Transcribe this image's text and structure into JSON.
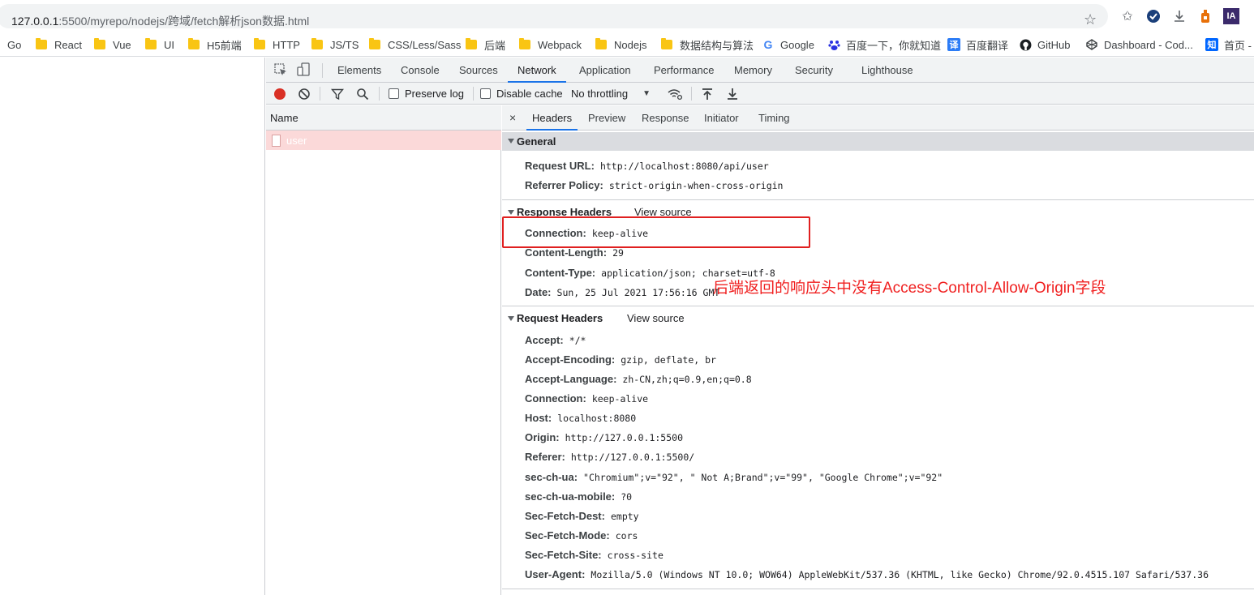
{
  "address_bar": {
    "info": "i",
    "url_host": "127.0.0.1",
    "url_rest": ":5500/myrepo/nodejs/跨域/fetch解析json数据.html"
  },
  "bookmarks": [
    {
      "label": "Go",
      "icon": "none"
    },
    {
      "label": "React",
      "icon": "folder"
    },
    {
      "label": "Vue",
      "icon": "folder"
    },
    {
      "label": "UI",
      "icon": "folder"
    },
    {
      "label": "H5前端",
      "icon": "folder"
    },
    {
      "label": "HTTP",
      "icon": "folder"
    },
    {
      "label": "JS/TS",
      "icon": "folder"
    },
    {
      "label": "CSS/Less/Sass",
      "icon": "folder"
    },
    {
      "label": "后端",
      "icon": "folder"
    },
    {
      "label": "Webpack",
      "icon": "folder"
    },
    {
      "label": "Nodejs",
      "icon": "folder"
    },
    {
      "label": "数据结构与算法",
      "icon": "folder"
    },
    {
      "label": "Google",
      "icon": "google-icon"
    },
    {
      "label": "百度一下，你就知道",
      "icon": "baidu-icon"
    },
    {
      "label": "百度翻译",
      "icon": "translate-icon"
    },
    {
      "label": "GitHub",
      "icon": "github-icon"
    },
    {
      "label": "Dashboard - Cod...",
      "icon": "codepen-icon"
    },
    {
      "label": "首页 -",
      "icon": "zhihu-icon"
    }
  ],
  "favicon_glyphs": {
    "translate": "译",
    "zhihu": "知",
    "ia": "IA"
  },
  "devtools": {
    "tabs": [
      "Elements",
      "Console",
      "Sources",
      "Network",
      "Application",
      "Performance",
      "Memory",
      "Security",
      "Lighthouse"
    ],
    "active_tab": "Network",
    "toolbar": {
      "preserve_log": "Preserve log",
      "disable_cache": "Disable cache",
      "throttling": "No throttling"
    },
    "request_list": {
      "header": "Name",
      "rows": [
        "user"
      ]
    },
    "detail_tabs": [
      "Headers",
      "Preview",
      "Response",
      "Initiator",
      "Timing"
    ],
    "active_detail_tab": "Headers",
    "close": "×",
    "general": {
      "title": "General",
      "rows": [
        {
          "key": "Request URL:",
          "value": "http://localhost:8080/api/user"
        },
        {
          "key": "Referrer Policy:",
          "value": "strict-origin-when-cross-origin"
        }
      ]
    },
    "response_headers": {
      "title": "Response Headers",
      "view_source": "View source",
      "rows": [
        {
          "key": "Connection:",
          "value": "keep-alive"
        },
        {
          "key": "Content-Length:",
          "value": "29"
        },
        {
          "key": "Content-Type:",
          "value": "application/json; charset=utf-8"
        },
        {
          "key": "Date:",
          "value": "Sun, 25 Jul 2021 17:56:16 GMT"
        }
      ]
    },
    "request_headers": {
      "title": "Request Headers",
      "view_source": "View source",
      "rows": [
        {
          "key": "Accept:",
          "value": "*/*"
        },
        {
          "key": "Accept-Encoding:",
          "value": "gzip, deflate, br"
        },
        {
          "key": "Accept-Language:",
          "value": "zh-CN,zh;q=0.9,en;q=0.8"
        },
        {
          "key": "Connection:",
          "value": "keep-alive"
        },
        {
          "key": "Host:",
          "value": "localhost:8080"
        },
        {
          "key": "Origin:",
          "value": "http://127.0.0.1:5500"
        },
        {
          "key": "Referer:",
          "value": "http://127.0.0.1:5500/"
        },
        {
          "key": "sec-ch-ua:",
          "value": "\"Chromium\";v=\"92\", \" Not A;Brand\";v=\"99\", \"Google Chrome\";v=\"92\""
        },
        {
          "key": "sec-ch-ua-mobile:",
          "value": "?0"
        },
        {
          "key": "Sec-Fetch-Dest:",
          "value": "empty"
        },
        {
          "key": "Sec-Fetch-Mode:",
          "value": "cors"
        },
        {
          "key": "Sec-Fetch-Site:",
          "value": "cross-site"
        },
        {
          "key": "User-Agent:",
          "value": "Mozilla/5.0 (Windows NT 10.0; WOW64) AppleWebKit/537.36 (KHTML, like Gecko) Chrome/92.0.4515.107 Safari/537.36"
        }
      ]
    }
  },
  "annotation": {
    "note": "后端返回的响应头中没有Access-Control-Allow-Origin字段",
    "color": "#f02020"
  },
  "colors": {
    "accent": "#1a73e8",
    "record": "#d93025",
    "request_row": "#fbd9d9",
    "folder": "#f9c513"
  }
}
